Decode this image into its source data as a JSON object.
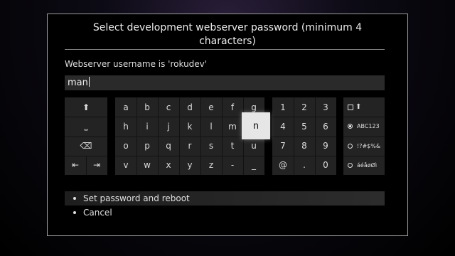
{
  "dialog": {
    "title_line1": "Select development webserver password (minimum 4",
    "title_line2": "characters)",
    "subtitle": "Webserver username is 'rokudev'",
    "input_value": "man"
  },
  "keyboard": {
    "control_keys": [
      {
        "name": "shift-key",
        "icon": "shift-up-arrow",
        "glyph": "⬆"
      },
      {
        "name": "space-key",
        "icon": "space-bar",
        "glyph": "⎵"
      },
      {
        "name": "backspace-key",
        "icon": "backspace",
        "glyph": "⌫"
      }
    ],
    "cursor_left_glyph": "⇤",
    "cursor_right_glyph": "⇥",
    "letter_rows": [
      [
        "a",
        "b",
        "c",
        "d",
        "e",
        "f",
        "g"
      ],
      [
        "h",
        "i",
        "j",
        "k",
        "l",
        "m",
        "n"
      ],
      [
        "o",
        "p",
        "q",
        "r",
        "s",
        "t",
        "u"
      ],
      [
        "v",
        "w",
        "x",
        "y",
        "z",
        "-",
        "_"
      ]
    ],
    "selected_key": "n",
    "number_rows": [
      [
        "1",
        "2",
        "3"
      ],
      [
        "4",
        "5",
        "6"
      ],
      [
        "7",
        "8",
        "9"
      ],
      [
        "@",
        ".",
        "0"
      ]
    ],
    "modes": {
      "caps_glyph": "⬆",
      "options": [
        "ABC123",
        "!?#$%&",
        "áéåøØì"
      ],
      "selected": "ABC123"
    }
  },
  "menu": {
    "items": [
      "Set password and reboot",
      "Cancel"
    ],
    "focused_index": 0
  },
  "colors": {
    "background": "#000000",
    "panel": "#232323",
    "selected_key": "#e6e6e6",
    "border": "#9a9a9a"
  }
}
